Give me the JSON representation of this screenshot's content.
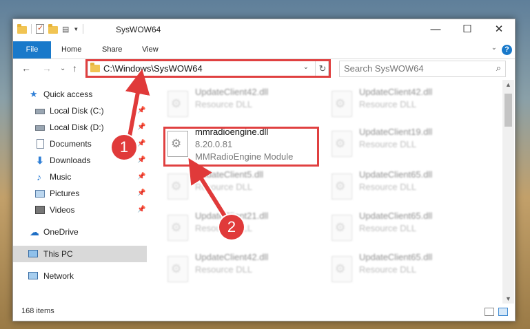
{
  "window": {
    "title": "SysWOW64",
    "minimize": "—",
    "maximize": "☐",
    "close": "✕"
  },
  "ribbon": {
    "tabs": [
      "File",
      "Home",
      "Share",
      "View"
    ],
    "expand": "⌄",
    "help": "?"
  },
  "nav": {
    "back": "←",
    "forward": "→",
    "recent": "⌄",
    "up": "↑",
    "address": "C:\\Windows\\SysWOW64",
    "address_dropdown": "⌄",
    "refresh": "↻",
    "search_placeholder": "Search SysWOW64",
    "search_icon": "⌕"
  },
  "sidebar": {
    "items": [
      {
        "label": "Quick access",
        "icon": "star-icon"
      },
      {
        "label": "Local Disk (C:)",
        "icon": "drive-icon",
        "pinned": true
      },
      {
        "label": "Local Disk (D:)",
        "icon": "drive-icon",
        "pinned": true
      },
      {
        "label": "Documents",
        "icon": "documents-icon",
        "pinned": true
      },
      {
        "label": "Downloads",
        "icon": "downloads-icon",
        "pinned": true
      },
      {
        "label": "Music",
        "icon": "music-icon",
        "pinned": true
      },
      {
        "label": "Pictures",
        "icon": "pictures-icon",
        "pinned": true
      },
      {
        "label": "Videos",
        "icon": "videos-icon",
        "pinned": true
      },
      {
        "label": "OneDrive",
        "icon": "cloud-icon"
      },
      {
        "label": "This PC",
        "icon": "computer-icon",
        "selected": true
      },
      {
        "label": "Network",
        "icon": "network-icon"
      }
    ],
    "pin_glyph": "📌"
  },
  "files": [
    {
      "name": "UpdateClient42.dll",
      "type": "Resource DLL"
    },
    {
      "name": "UpdateClient42.dll",
      "type": "Resource DLL"
    },
    {
      "name": "mmradioengine.dll",
      "version": "8.20.0.81",
      "description": "MMRadioEngine Module",
      "highlighted": true
    },
    {
      "name": "UpdateClient19.dll",
      "type": "Resource DLL"
    },
    {
      "name": "UpdateClient5.dll",
      "type": "Resource DLL"
    },
    {
      "name": "UpdateClient65.dll",
      "type": "Resource DLL"
    },
    {
      "name": "UpdateClient21.dll",
      "type": "Resource DLL"
    },
    {
      "name": "UpdateClient65.dll",
      "type": "Resource DLL"
    },
    {
      "name": "UpdateClient42.dll",
      "type": "Resource DLL"
    },
    {
      "name": "UpdateClient65.dll",
      "type": "Resource DLL"
    }
  ],
  "status": {
    "item_count": "168 items"
  },
  "annotations": {
    "badge1": "1",
    "badge2": "2",
    "color": "#e03a3a"
  },
  "colors": {
    "accent": "#1979ca",
    "highlight_border": "#e04040"
  }
}
